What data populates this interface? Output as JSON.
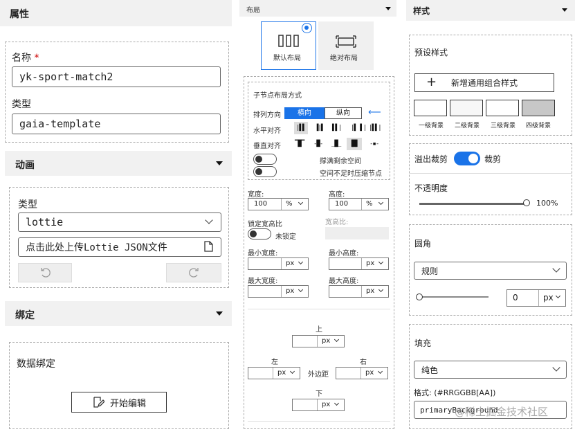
{
  "col1": {
    "title": "属性",
    "name_label": "名称",
    "required_mark": "*",
    "name_value": "yk-sport-match2",
    "type_label": "类型",
    "type_value": "gaia-template",
    "animation": {
      "title": "动画",
      "type_label": "类型",
      "type_value": "lottie",
      "upload_text": "点击此处上传Lottie JSON文件"
    },
    "binding": {
      "title": "绑定",
      "data_label": "数据绑定",
      "edit_button": "开始编辑"
    }
  },
  "col2": {
    "title": "布局",
    "default_layout": "默认布局",
    "absolute_layout": "绝对布局",
    "child_layout_title": "子节点布局方式",
    "direction_label": "排列方向",
    "dir_horizontal": "横向",
    "dir_vertical": "纵向",
    "h_align_label": "水平对齐",
    "v_align_label": "垂直对齐",
    "fill_space": "撑满剩余空间",
    "shrink": "空间不足时压缩节点",
    "width_label": "宽度:",
    "width_value": "100",
    "width_unit": "%",
    "height_label": "高度:",
    "height_value": "100",
    "height_unit": "%",
    "lock_ratio_label": "锁定宽高比",
    "ratio_label": "宽高比:",
    "unlocked": "未锁定",
    "min_width": "最小宽度:",
    "min_height": "最小高度:",
    "max_width": "最大宽度:",
    "max_height": "最大高度:",
    "px": "px",
    "top": "上",
    "left": "左",
    "right": "右",
    "bottom": "下",
    "margin": "外边距"
  },
  "col3": {
    "title": "样式",
    "preset_title": "预设样式",
    "add_button": "新增通用组合样式",
    "swatches": [
      {
        "label": "一级背景",
        "color": "#ffffff"
      },
      {
        "label": "二级背景",
        "color": "#f7f7f7"
      },
      {
        "label": "三级背景",
        "color": "#ffffff"
      },
      {
        "label": "四级背景",
        "color": "#c7c7c7"
      }
    ],
    "overflow_label": "溢出裁剪",
    "overflow_value": "裁剪",
    "opacity_label": "不透明度",
    "opacity_value": "100%",
    "opacity_level": 1.0,
    "radius_title": "圆角",
    "radius_mode": "规则",
    "radius_value": "0",
    "radius_unit": "px",
    "fill_title": "填充",
    "fill_mode": "纯色",
    "format_label": "格式: (#RRGGBB[AA])",
    "fill_value": "primaryBackground",
    "watermark": "@稀土掘金技术社区"
  },
  "colors": {
    "accent": "#1a73e8",
    "panel": "#f1f1f1"
  }
}
